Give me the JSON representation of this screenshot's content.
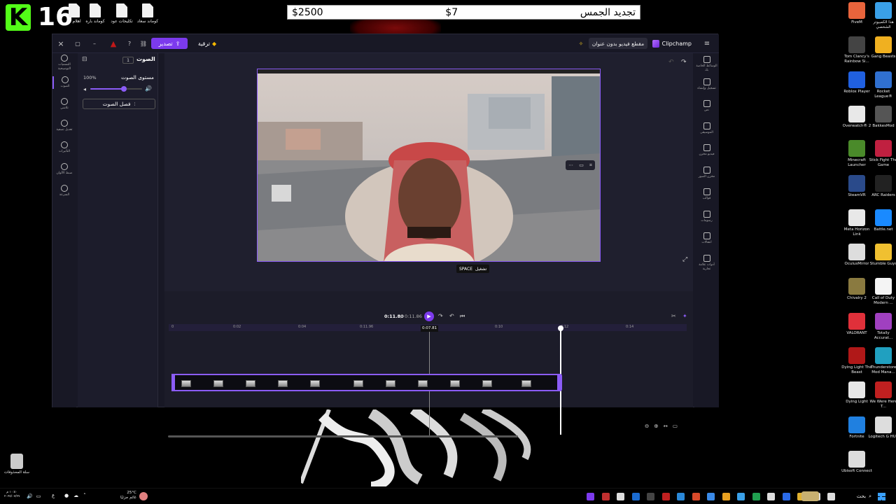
{
  "stream_overlay": {
    "logo": "K",
    "number": "16"
  },
  "top_files": [
    "اهلام الـ",
    "كوماند باره",
    "تكليحات عود",
    "كوماند سعاد"
  ],
  "price_bar": {
    "item": "تجديد الجمس",
    "price": "$7",
    "balance": "$2500"
  },
  "desktop_icons": [
    {
      "label": "FiveM",
      "color": "#e8643c"
    },
    {
      "label": "هذا الكمبيوتر الشخصي",
      "color": "#3aa0e8"
    },
    {
      "label": "Tom Clancy's Rainbow Si...",
      "color": "#444"
    },
    {
      "label": "Gang Beasts",
      "color": "#f0b020"
    },
    {
      "label": "Roblox Player",
      "color": "#2060e0"
    },
    {
      "label": "Rocket League®",
      "color": "#3070d0"
    },
    {
      "label": "Overwatch® 2",
      "color": "#e8e8e8"
    },
    {
      "label": "BakkesMod",
      "color": "#555"
    },
    {
      "label": "Minecraft Launcher",
      "color": "#4a8a2a"
    },
    {
      "label": "Stick Fight The Game",
      "color": "#c02040"
    },
    {
      "label": "SteamVR",
      "color": "#2a4a8a"
    },
    {
      "label": "ARC Raiders",
      "color": "#222"
    },
    {
      "label": "Meta Horizon Link",
      "color": "#e8e8e8"
    },
    {
      "label": "Battle.net",
      "color": "#1a8aff"
    },
    {
      "label": "OculusMirror",
      "color": "#ddd"
    },
    {
      "label": "Stumble Guys",
      "color": "#f0c030"
    },
    {
      "label": "Chivalry 2",
      "color": "#8a7a40"
    },
    {
      "label": "Call of Duty Modern ...",
      "color": "#f4f4f4"
    },
    {
      "label": "VALORANT",
      "color": "#e0303a"
    },
    {
      "label": "Totally Accurat...",
      "color": "#a040c0"
    },
    {
      "label": "Dying Light The Beast",
      "color": "#b01818"
    },
    {
      "label": "Thunderstore Mod Mana...",
      "color": "#20a0c0"
    },
    {
      "label": "Dying Light",
      "color": "#e8e8e8"
    },
    {
      "label": "We Were Here T...",
      "color": "#c02020"
    },
    {
      "label": "Fortnite",
      "color": "#2080e0"
    },
    {
      "label": "Logitech G HUB",
      "color": "#ddd"
    },
    {
      "label": "Ubisoft Connect",
      "color": "#ddd"
    }
  ],
  "recycle_bin": "سلة المحذوفات",
  "app": {
    "brand": "Clipchamp",
    "project_title": "مقطع فيديو بدون عنوان",
    "upgrade": "ترقية",
    "export": "تصدير",
    "left_rail": [
      "التسميات التوضيحية",
      "الصوت",
      "تلاشي",
      "تعديل تصفية",
      "التأثيرات",
      "ضبط الألوان",
      "السرعة"
    ],
    "audio_panel": {
      "title": "الصوت",
      "badge": "1",
      "volume_label": "مستوى الصوت",
      "volume_value": "100%",
      "volume_level": 0.65,
      "separate_audio": "فصل الصوت"
    },
    "right_rail": [
      "الوسائط الخاصة بك",
      "تسجيل وإنشاء",
      "نص",
      "الموسيقى",
      "فيديو مخزن",
      "مخزن الصور",
      "قوالب",
      "رسومات",
      "انتقالات",
      "أدوات علامة تجارية"
    ],
    "playback": {
      "tooltip": "تشغيل",
      "tooltip_key": "SPACE",
      "current_time": "0:11.80",
      "total_time": "0:11.86",
      "playhead_time": "0:07.81"
    },
    "ruler_ticks": [
      "0",
      "0:02",
      "0:04",
      "0:11.96",
      "0:10",
      "0:12",
      "0:14"
    ]
  },
  "taskbar": {
    "weather_temp": "25°C",
    "weather_label": "غائم جزئيًا",
    "time": "١٠:٥٠ م",
    "date": "٢٠٢٥/٠٧/٢٧",
    "lang": "ع",
    "search": "بحث"
  }
}
